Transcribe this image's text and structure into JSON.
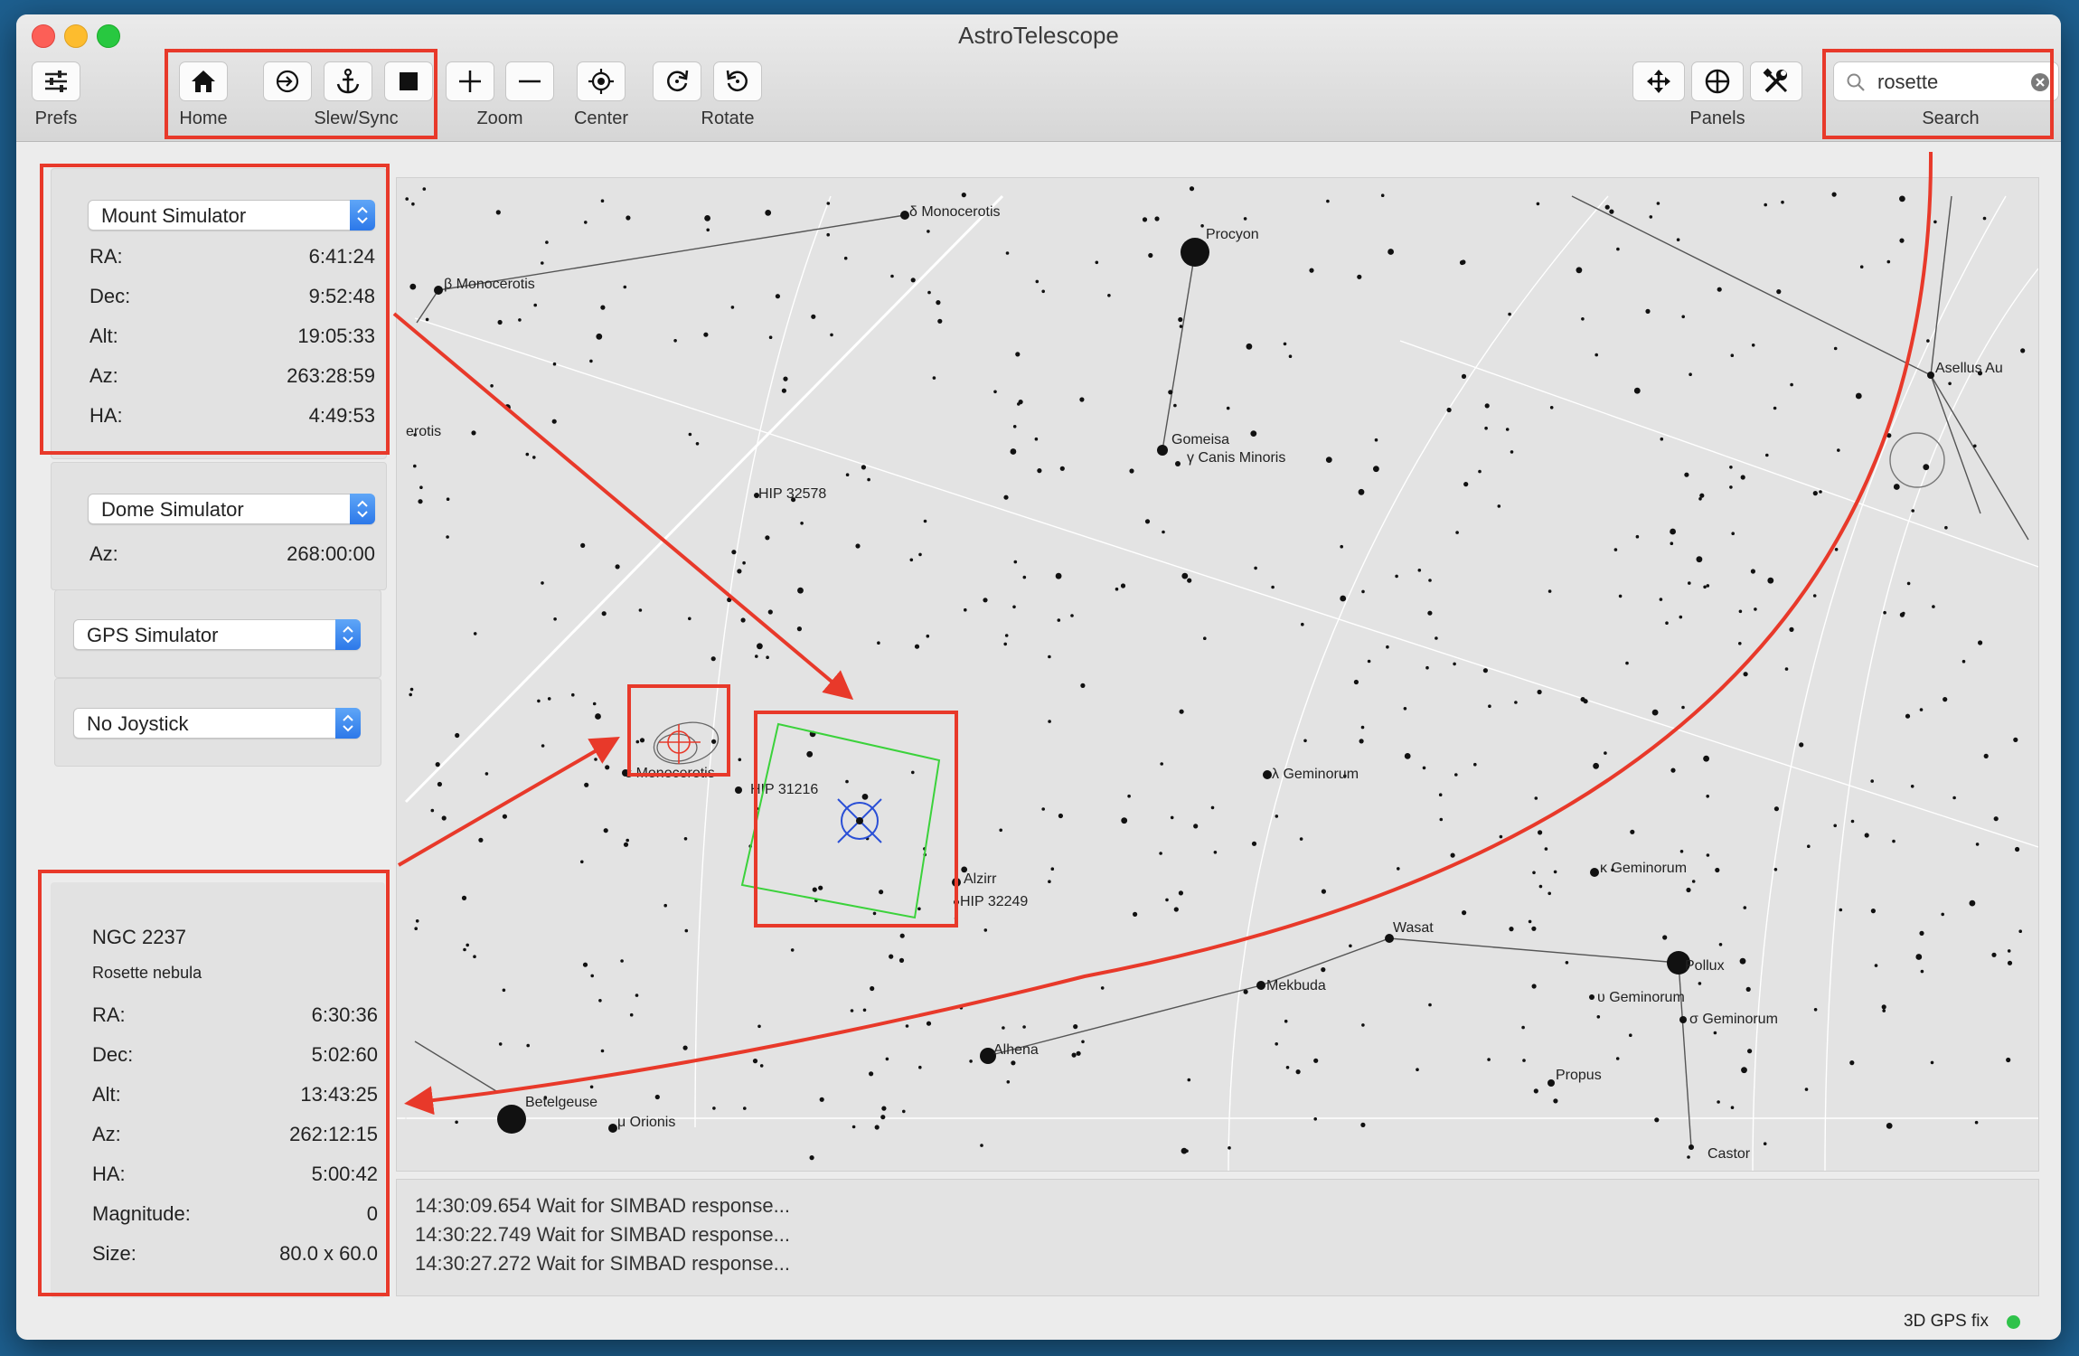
{
  "window": {
    "title": "AstroTelescope"
  },
  "toolbar": {
    "prefs": "Prefs",
    "home": "Home",
    "slew_sync": "Slew/Sync",
    "zoom": "Zoom",
    "center": "Center",
    "rotate": "Rotate",
    "panels": "Panels",
    "search": "Search",
    "search_value": "rosette"
  },
  "mount": {
    "device": "Mount Simulator",
    "rows": [
      {
        "k": "RA:",
        "v": "6:41:24"
      },
      {
        "k": "Dec:",
        "v": "9:52:48"
      },
      {
        "k": "Alt:",
        "v": "19:05:33"
      },
      {
        "k": "Az:",
        "v": "263:28:59"
      },
      {
        "k": "HA:",
        "v": "4:49:53"
      }
    ]
  },
  "dome": {
    "device": "Dome Simulator",
    "az_label": "Az:",
    "az_value": "268:00:00"
  },
  "gps": {
    "device": "GPS Simulator"
  },
  "joystick": {
    "device": "No Joystick"
  },
  "object": {
    "name": "NGC 2237",
    "desc": "Rosette nebula",
    "rows": [
      {
        "k": "RA:",
        "v": "6:30:36"
      },
      {
        "k": "Dec:",
        "v": "5:02:60"
      },
      {
        "k": "Alt:",
        "v": "13:43:25"
      },
      {
        "k": "Az:",
        "v": "262:12:15"
      },
      {
        "k": "HA:",
        "v": "5:00:42"
      },
      {
        "k": "Magnitude:",
        "v": "0"
      },
      {
        "k": "Size:",
        "v": "80.0 x 60.0"
      }
    ]
  },
  "sky": {
    "labels": {
      "delta_mon": "δ Monocerotis",
      "procyon": "Procyon",
      "beta_mon": "β Monocerotis",
      "rotis": "erotis",
      "gomeisa": "Gomeisa",
      "gamma_cmi": "γ Canis Minoris",
      "hip32578": "HIP 32578",
      "asellus": "Asellus Au",
      "eps_mon": "ε Monocerotis",
      "hip31216": "HIP 31216",
      "lambda_gem": "λ Geminorum",
      "alzirr": "Alzirr",
      "hip32249": "HIP 32249",
      "kappa_gem": "κ Geminorum",
      "wasat": "Wasat",
      "pollux": "Pollux",
      "mekbuda": "Mekbuda",
      "upsilon_gem": "υ Geminorum",
      "sigma_gem": "σ Geminorum",
      "alhena": "Alhena",
      "propus": "Propus",
      "betelgeuse": "Betelgeuse",
      "mu_ori": "μ Orionis",
      "castor": "Castor"
    }
  },
  "log": {
    "lines": [
      "14:30:09.654 Wait for SIMBAD response...",
      "14:30:22.749 Wait for SIMBAD response...",
      "14:30:27.272 Wait for SIMBAD response..."
    ]
  },
  "status": {
    "gps_fix": "3D GPS fix",
    "fix_color": "#2fc24a"
  },
  "colors": {
    "annotation": "#e8392a",
    "fov": "#3bd23b",
    "crosshair": "#2a4fd6"
  }
}
